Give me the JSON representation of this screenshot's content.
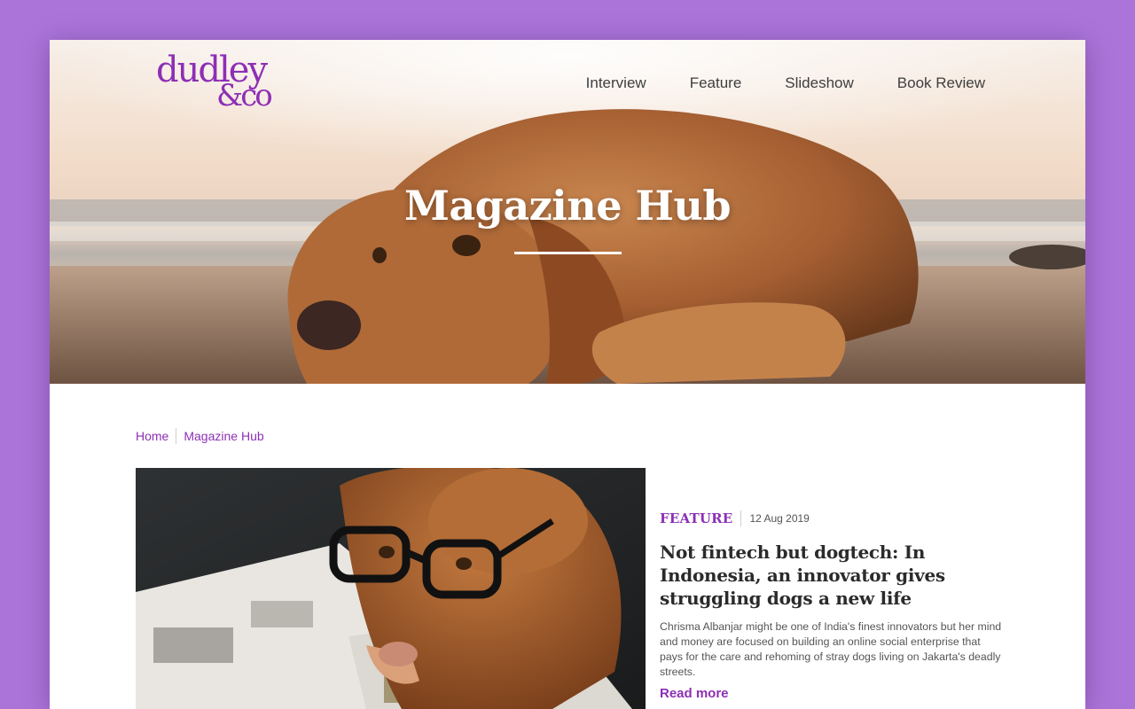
{
  "brand": {
    "logo_line1": "dudley",
    "logo_line2": "&co",
    "color": "#8d2fb5"
  },
  "nav": {
    "items": [
      {
        "label": "Interview"
      },
      {
        "label": "Feature"
      },
      {
        "label": "Slideshow"
      },
      {
        "label": "Book Review"
      }
    ]
  },
  "hero": {
    "title": "Magazine Hub",
    "image_icon": "beach-dog-photo"
  },
  "breadcrumb": {
    "items": [
      {
        "label": "Home"
      },
      {
        "label": "Magazine Hub"
      }
    ]
  },
  "article": {
    "image_icon": "dog-with-glasses-photo",
    "category": "FEATURE",
    "date": "12 Aug 2019",
    "headline": "Not fintech but dogtech: In Indonesia, an innovator gives struggling dogs a new life",
    "summary": "Chrisma Albanjar might be one of India's finest innovators but her mind and money are focused on building an online social enterprise that pays for the care and rehoming of stray dogs living on Jakarta's deadly streets.",
    "cta": "Read more"
  },
  "colors": {
    "background": "#ab74d9",
    "accent": "#8d2fb5",
    "text": "#2b2b2b"
  }
}
